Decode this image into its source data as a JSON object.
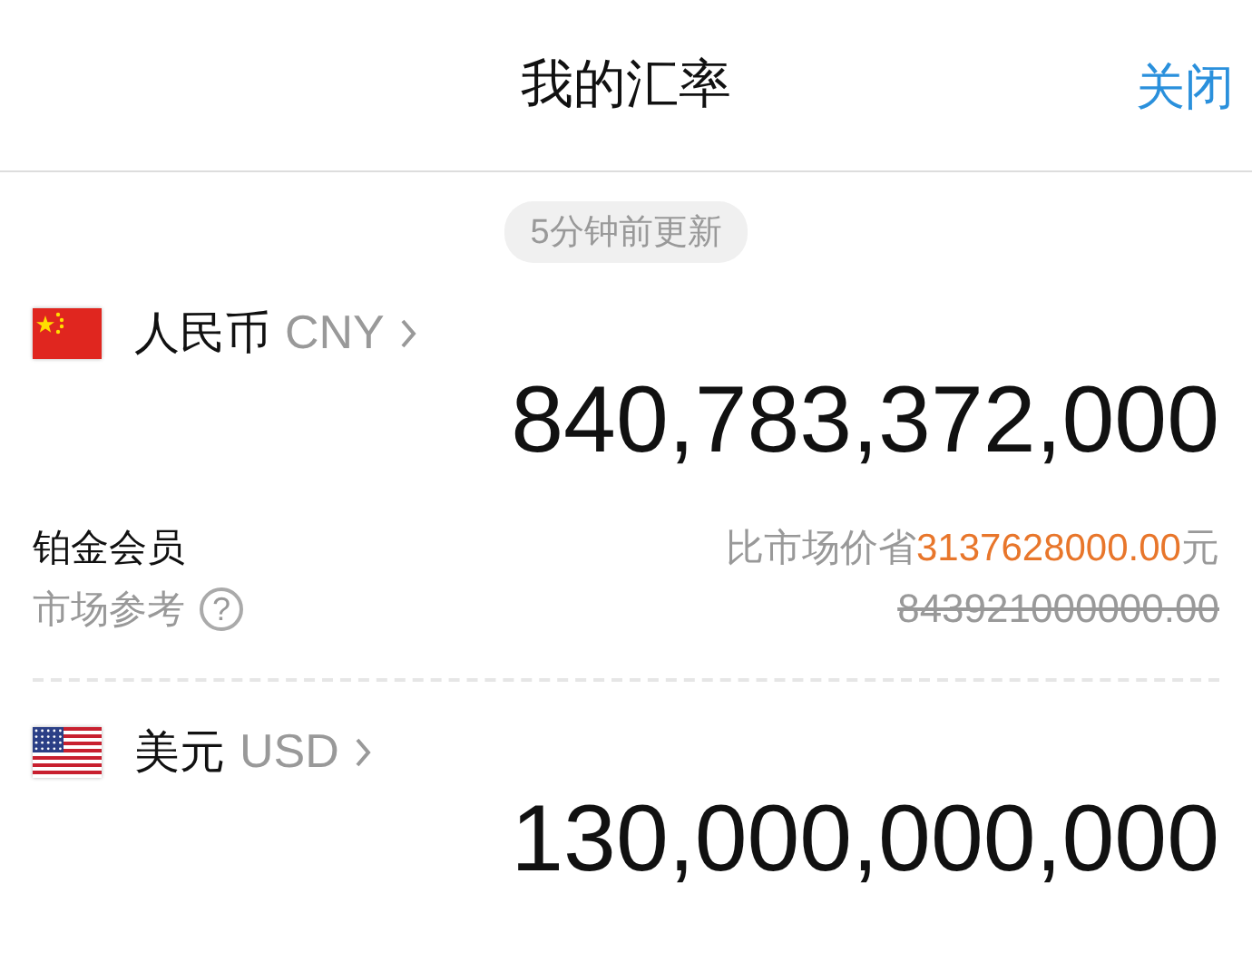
{
  "header": {
    "title": "我的汇率",
    "close": "关闭"
  },
  "update_badge": "5分钟前更新",
  "currencies": [
    {
      "kind": "cn",
      "name": "人民币",
      "code": "CNY",
      "amount": "840,783,372,000",
      "member_label": "铂金会员",
      "savings": {
        "prefix": "比市场价省",
        "value": "3137628000.00",
        "suffix": "元"
      },
      "market_label": "市场参考",
      "help": "?",
      "market_price": "843921000000.00"
    },
    {
      "kind": "us",
      "name": "美元",
      "code": "USD",
      "amount": "130,000,000,000"
    }
  ]
}
